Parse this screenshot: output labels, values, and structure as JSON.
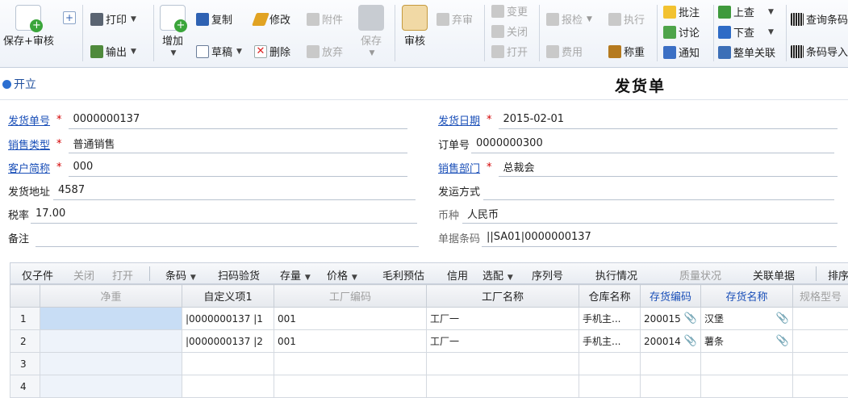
{
  "ribbon": {
    "save_audit": "保存+审核",
    "print": "打印",
    "output": "输出",
    "add": "增加",
    "copy": "复制",
    "draft": "草稿",
    "modify": "修改",
    "delete": "删除",
    "attach": "附件",
    "discard": "放弃",
    "save": "保存",
    "audit": "审核",
    "abandon": "弃审",
    "change": "变更",
    "close": "关闭",
    "open": "打开",
    "inspect": "报检",
    "fee": "费用",
    "execute": "执行",
    "weigh": "称重",
    "annotate": "批注",
    "discuss": "讨论",
    "notify": "通知",
    "query_up": "上查",
    "query_down": "下查",
    "link_all": "整单关联",
    "barcode_query": "查询条码",
    "barcode_import": "条码导入"
  },
  "titlebar": {
    "state": "开立",
    "title": "发货单"
  },
  "form": {
    "doc_no_label": "发货单号",
    "doc_no": "0000000137",
    "sale_type_label": "销售类型",
    "sale_type": "普通销售",
    "customer_label": "客户简称",
    "customer": "000",
    "address_label": "发货地址",
    "address": "4587",
    "tax_label": "税率",
    "tax": "17.00",
    "note_label": "备注",
    "note": "",
    "date_label": "发货日期",
    "date": "2015-02-01",
    "order_label": "订单号",
    "order": "0000000300",
    "dept_label": "销售部门",
    "dept": "总裁会",
    "ship_method_label": "发运方式",
    "ship_method": "",
    "currency_label": "币种",
    "currency": "人民币",
    "barcode_label": "单据条码",
    "barcode": "||SA01|0000000137",
    "required_mark": "*"
  },
  "grid_toolbar": {
    "child": "仅子件",
    "close": "关闭",
    "open": "打开",
    "barcode": "条码",
    "scan": "扫码验货",
    "stock": "存量",
    "price": "价格",
    "profit": "毛利预估",
    "credit": "信用",
    "select": "选配",
    "serial": "序列号",
    "exec": "执行情况",
    "quality": "质量状况",
    "link_doc": "关联单据",
    "sort": "排序"
  },
  "grid": {
    "columns": [
      "",
      "净重",
      "自定义项1",
      "工厂编码",
      "工厂名称",
      "仓库名称",
      "存货编码",
      "存货名称",
      "规格型号"
    ],
    "rows": [
      [
        "1",
        "",
        "|0000000137 |1",
        "001",
        "工厂一",
        "手机主...",
        "200015",
        "汉堡",
        ""
      ],
      [
        "2",
        "",
        "|0000000137 |2",
        "001",
        "工厂一",
        "手机主...",
        "200014",
        "薯条",
        ""
      ],
      [
        "3",
        "",
        "",
        "",
        "",
        "",
        "",
        "",
        ""
      ],
      [
        "4",
        "",
        "",
        "",
        "",
        "",
        "",
        "",
        ""
      ]
    ]
  },
  "colors": {
    "accent": "#1a4fb8",
    "required": "#d40000",
    "selected_cell": "#c8ddf5"
  },
  "icons": {
    "attachment": "paperclip-icon",
    "state": "status-dot-icon"
  }
}
